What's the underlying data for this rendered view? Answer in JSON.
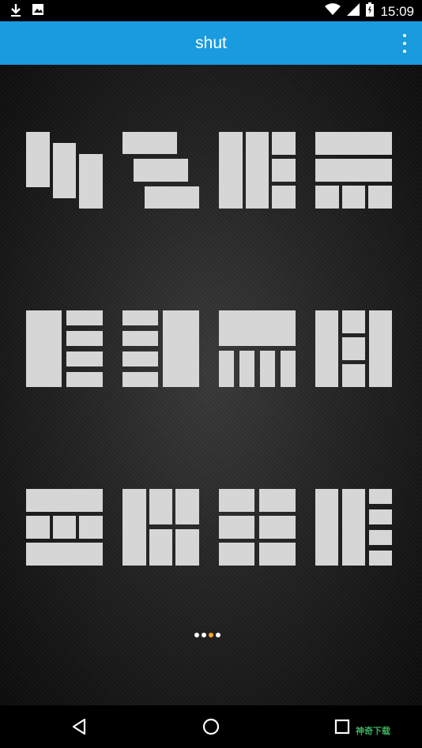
{
  "status_bar": {
    "time": "15:09",
    "icons": [
      "download-icon",
      "image-icon",
      "wifi-icon",
      "signal-icon",
      "battery-icon"
    ]
  },
  "app_bar": {
    "title": "shut",
    "menu_icon": "overflow-menu-icon"
  },
  "colors": {
    "app_bar": "#1a9be0",
    "tile": "#d6d6d6",
    "page_active": "#f5a623",
    "page_inactive": "#ffffff"
  },
  "layouts": {
    "count": 12,
    "icon": "grid-layout-icon"
  },
  "pager": {
    "page_count": 4,
    "current_page": 3
  },
  "nav_bar": {
    "buttons": [
      "back-icon",
      "home-icon",
      "recents-icon"
    ]
  },
  "watermark": "神奇下载"
}
